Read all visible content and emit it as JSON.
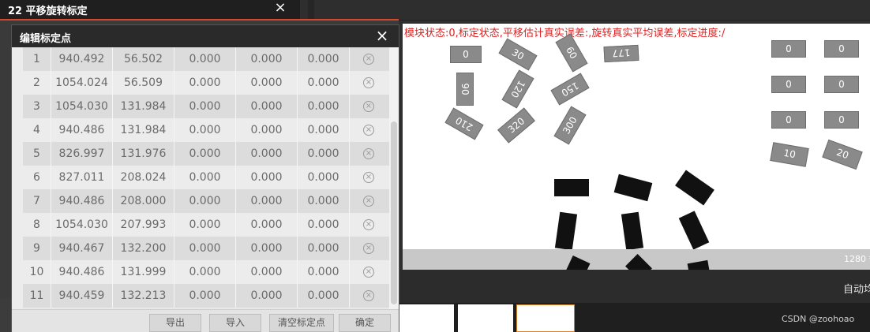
{
  "outer_window": {
    "title": "22 平移旋转标定",
    "close_icon": "×"
  },
  "dialog": {
    "title": "编辑标定点",
    "close_icon": "×",
    "rows": [
      [
        "1",
        "940.492",
        "56.502",
        "0.000",
        "0.000",
        "0.000"
      ],
      [
        "2",
        "1054.024",
        "56.509",
        "0.000",
        "0.000",
        "0.000"
      ],
      [
        "3",
        "1054.030",
        "131.984",
        "0.000",
        "0.000",
        "0.000"
      ],
      [
        "4",
        "940.486",
        "131.984",
        "0.000",
        "0.000",
        "0.000"
      ],
      [
        "5",
        "826.997",
        "131.976",
        "0.000",
        "0.000",
        "0.000"
      ],
      [
        "6",
        "827.011",
        "208.024",
        "0.000",
        "0.000",
        "0.000"
      ],
      [
        "7",
        "940.486",
        "208.000",
        "0.000",
        "0.000",
        "0.000"
      ],
      [
        "8",
        "1054.030",
        "207.993",
        "0.000",
        "0.000",
        "0.000"
      ],
      [
        "9",
        "940.467",
        "132.200",
        "0.000",
        "0.000",
        "0.000"
      ],
      [
        "10",
        "940.486",
        "131.999",
        "0.000",
        "0.000",
        "0.000"
      ],
      [
        "11",
        "940.459",
        "132.213",
        "0.000",
        "0.000",
        "0.000"
      ]
    ],
    "buttons": {
      "export": "导出",
      "import": "导入",
      "clear": "清空标定点",
      "confirm": "确定"
    }
  },
  "camera": {
    "status_text": "模块状态:0,标定状态,平移估计真实误差:,旋转真实平均误差,标定进度:/",
    "resolution_text": "1280 *",
    "chips": {
      "a": "0",
      "b": "30",
      "c": "60",
      "d": "177",
      "e": "90",
      "f": "120",
      "g": "150",
      "h": "210",
      "i": "320",
      "j": "300",
      "k1": "0",
      "k2": "0",
      "k3": "0",
      "k4": "0",
      "k5": "0",
      "k6": "0",
      "l1": "10",
      "l2": "20"
    }
  },
  "auto_text": "自动均",
  "watermark": "CSDN @zoohoao"
}
